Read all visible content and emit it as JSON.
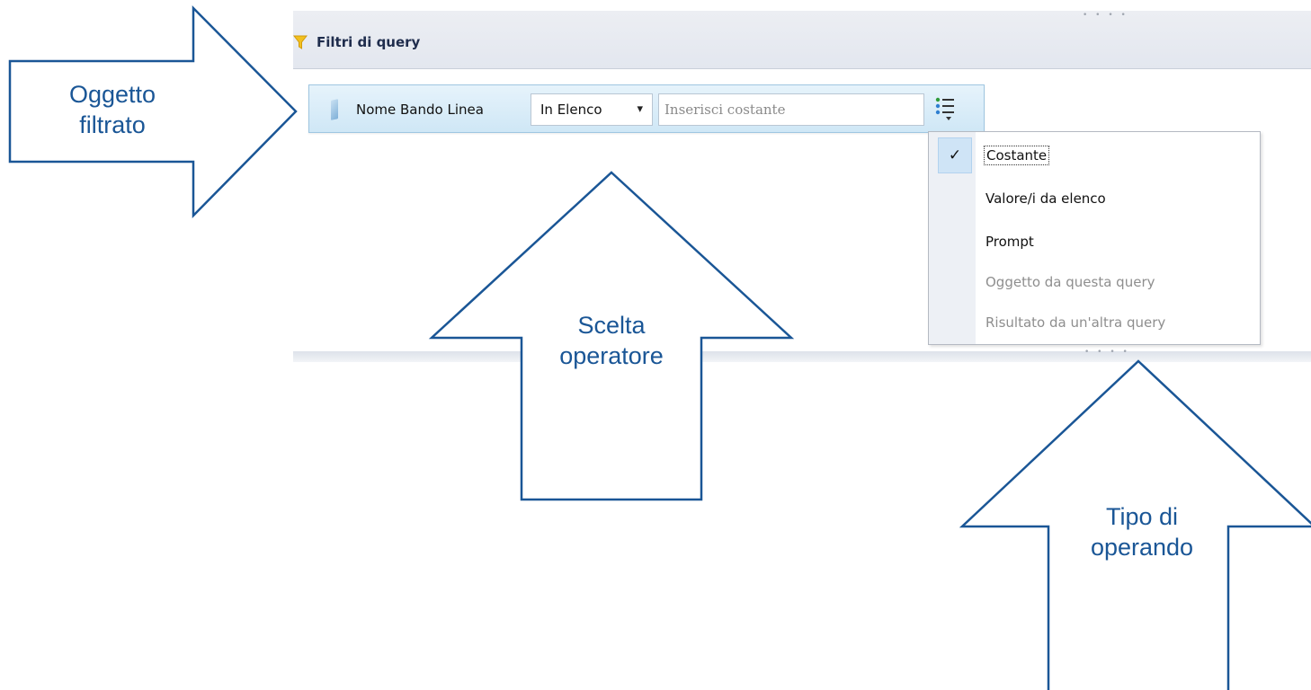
{
  "panel": {
    "title": "Filtri di query",
    "grip": "• • • •"
  },
  "filter": {
    "object_name": "Nome Bando Linea",
    "operator": "In Elenco",
    "operand_placeholder": "Inserisci costante"
  },
  "menu": {
    "items": [
      {
        "label": "Costante",
        "checked": true,
        "enabled": true
      },
      {
        "label": "Valore/i da elenco",
        "enabled": true
      },
      {
        "label": "Prompt",
        "enabled": true
      },
      {
        "label": "Oggetto da questa query",
        "enabled": false
      },
      {
        "label": "Risultato da un'altra query",
        "enabled": false
      }
    ]
  },
  "callouts": {
    "filtered_object": [
      "Oggetto",
      "filtrato"
    ],
    "operator_choice": [
      "Scelta",
      "operatore"
    ],
    "operand_type": [
      "Tipo di",
      "operando"
    ]
  },
  "colors": {
    "accent": "#1a5696",
    "funnel": "#f2c01e",
    "row_bg": "#d9edf9"
  },
  "icons": {
    "panel": "funnel-icon",
    "object": "dimension-object-icon",
    "operand": "operand-type-list-icon"
  }
}
